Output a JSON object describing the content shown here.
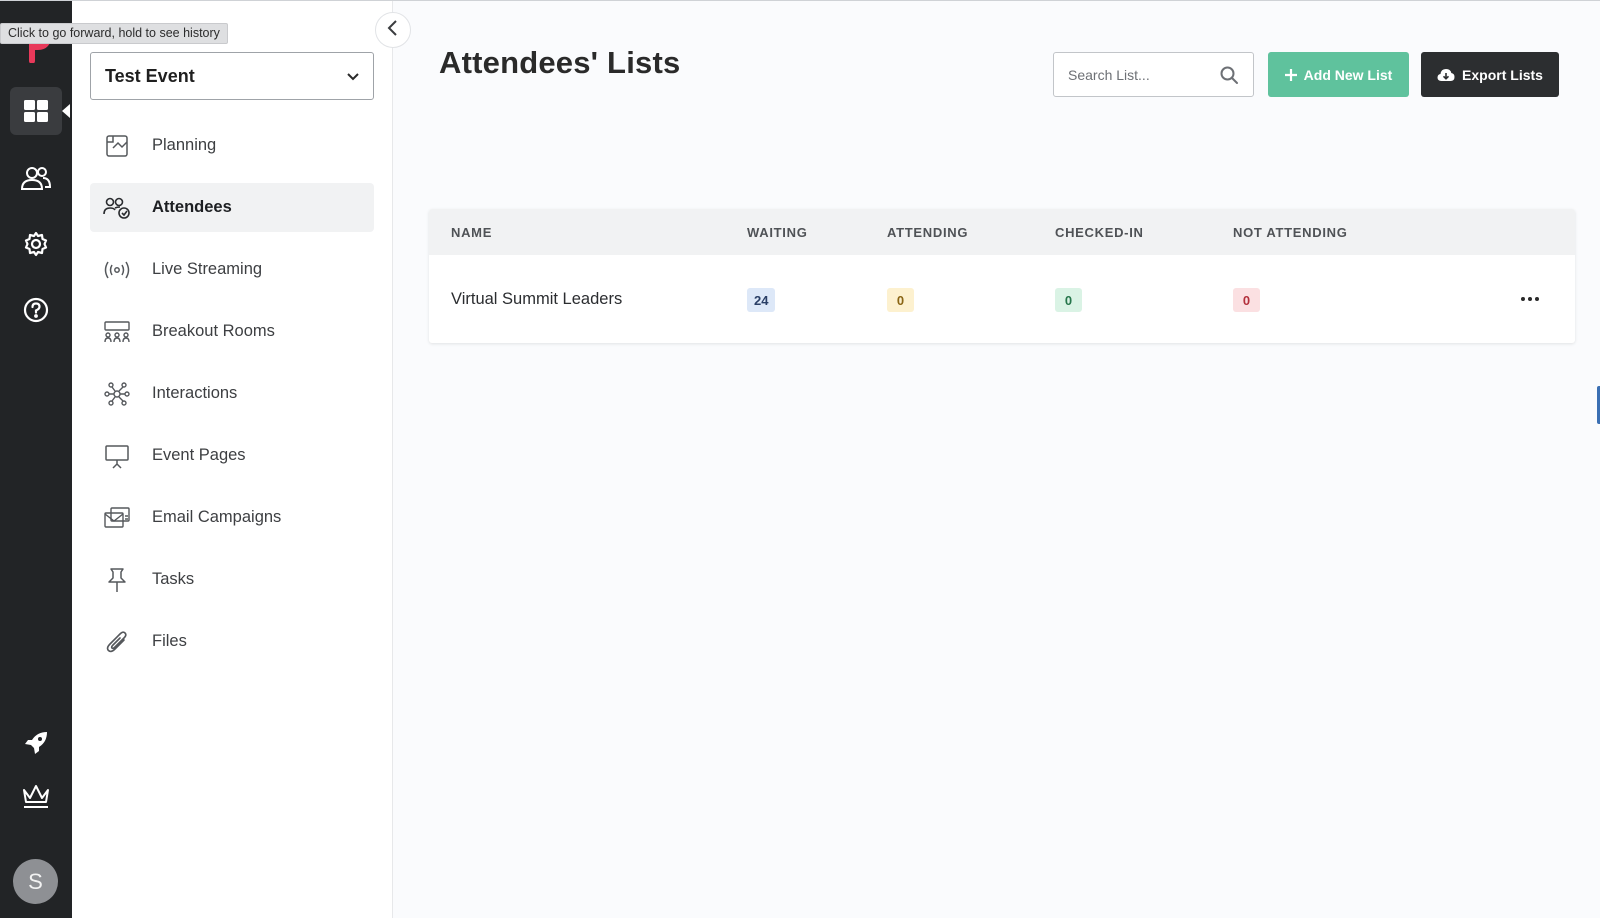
{
  "tooltip": "Click to go forward, hold to see history",
  "rail": {
    "logo": "brand-logo",
    "items": [
      "dashboard-icon",
      "people-icon",
      "gear-icon",
      "help-icon"
    ],
    "bottom": [
      "rocket-icon",
      "crown-icon"
    ],
    "avatar_initial": "S"
  },
  "sidebar": {
    "event_name": "Test Event",
    "items": [
      {
        "label": "Planning",
        "icon": "planning-icon"
      },
      {
        "label": "Attendees",
        "icon": "attendees-icon",
        "active": true
      },
      {
        "label": "Live Streaming",
        "icon": "broadcast-icon"
      },
      {
        "label": "Breakout Rooms",
        "icon": "breakout-rooms-icon"
      },
      {
        "label": "Interactions",
        "icon": "network-icon"
      },
      {
        "label": "Event Pages",
        "icon": "presentation-icon"
      },
      {
        "label": "Email Campaigns",
        "icon": "email-icon"
      },
      {
        "label": "Tasks",
        "icon": "pin-icon"
      },
      {
        "label": "Files",
        "icon": "paperclip-icon"
      }
    ]
  },
  "main": {
    "title": "Attendees' Lists",
    "search": {
      "placeholder": "Search List..."
    },
    "add_button": "Add New List",
    "export_button": "Export Lists",
    "table": {
      "headers": [
        "NAME",
        "WAITING",
        "ATTENDING",
        "CHECKED-IN",
        "NOT ATTENDING"
      ],
      "rows": [
        {
          "name": "Virtual Summit Leaders",
          "waiting": "24",
          "attending": "0",
          "checked_in": "0",
          "not_attending": "0"
        }
      ]
    }
  },
  "colors": {
    "rail_bg": "#222426",
    "brand": "#e8395a",
    "add_button": "#5fc29d",
    "export_button": "#2c2e30"
  }
}
